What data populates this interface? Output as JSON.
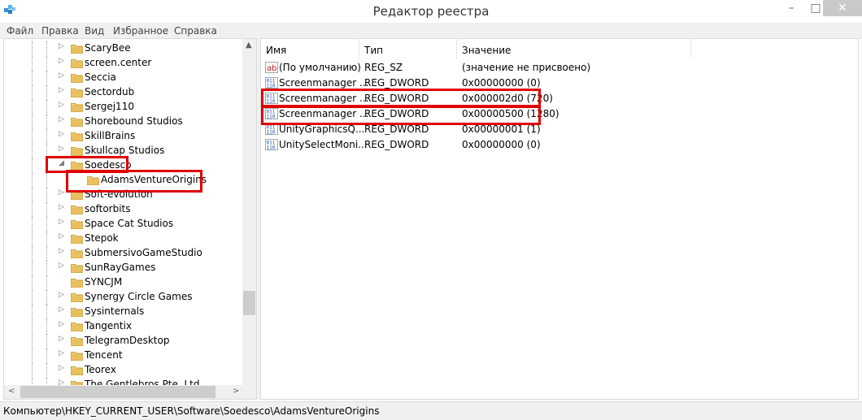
{
  "window": {
    "title": "Редактор реестра",
    "minimize": "–",
    "maximize": "□",
    "close": "✕"
  },
  "menu": [
    "Файл",
    "Правка",
    "Вид",
    "Избранное",
    "Справка"
  ],
  "tree": {
    "items": [
      {
        "label": "ScaryBee",
        "expander": "▷"
      },
      {
        "label": "screen.center",
        "expander": "▷"
      },
      {
        "label": "Seccia",
        "expander": "▷"
      },
      {
        "label": "Sectordub",
        "expander": "▷"
      },
      {
        "label": "Sergej110",
        "expander": "▷"
      },
      {
        "label": "Shorebound Studios",
        "expander": "▷"
      },
      {
        "label": "SkillBrains",
        "expander": "▷"
      },
      {
        "label": "Skullcap Studios",
        "expander": "▷"
      },
      {
        "label": "Soedesco",
        "expander": "◢",
        "highlighted": true
      },
      {
        "label": "AdamsVentureOrigins",
        "expander": "",
        "child": true,
        "selected": true,
        "highlighted": true
      },
      {
        "label": "Soft-evolution",
        "expander": "▷"
      },
      {
        "label": "softorbits",
        "expander": "▷"
      },
      {
        "label": "Space Cat Studios",
        "expander": "▷"
      },
      {
        "label": "Stepok",
        "expander": "▷"
      },
      {
        "label": "SubmersivoGameStudio",
        "expander": "▷"
      },
      {
        "label": "SunRayGames",
        "expander": "▷"
      },
      {
        "label": "SYNCJM",
        "expander": ""
      },
      {
        "label": "Synergy Circle Games",
        "expander": "▷"
      },
      {
        "label": "Sysinternals",
        "expander": "▷"
      },
      {
        "label": "Tangentix",
        "expander": "▷"
      },
      {
        "label": "TelegramDesktop",
        "expander": "▷"
      },
      {
        "label": "Tencent",
        "expander": "▷"
      },
      {
        "label": "Teorex",
        "expander": "▷"
      },
      {
        "label": "The Gentlebros Pte. Ltd",
        "expander": "▷"
      }
    ]
  },
  "scroll": {
    "up": "▲",
    "down": "▼",
    "left": "<",
    "right": ">"
  },
  "values": {
    "columns": {
      "name": "Имя",
      "type": "Тип",
      "data": "Значение"
    },
    "rows": [
      {
        "icon": "ab",
        "name": "(По умолчанию)",
        "type": "REG_SZ",
        "data": "(значение не присвоено)",
        "highlighted": false
      },
      {
        "icon": "dword",
        "name": "Screenmanager ...",
        "type": "REG_DWORD",
        "data": "0x00000000 (0)",
        "highlighted": false
      },
      {
        "icon": "dword",
        "name": "Screenmanager ...",
        "type": "REG_DWORD",
        "data": "0x000002d0 (720)",
        "highlighted": true
      },
      {
        "icon": "dword",
        "name": "Screenmanager ...",
        "type": "REG_DWORD",
        "data": "0x00000500 (1280)",
        "highlighted": true
      },
      {
        "icon": "dword",
        "name": "UnityGraphicsQ...",
        "type": "REG_DWORD",
        "data": "0x00000001 (1)",
        "highlighted": false
      },
      {
        "icon": "dword",
        "name": "UnitySelectMoni...",
        "type": "REG_DWORD",
        "data": "0x00000000 (0)",
        "highlighted": false
      }
    ]
  },
  "status": {
    "path": "Компьютер\\HKEY_CURRENT_USER\\Software\\Soedesco\\AdamsVentureOrigins"
  },
  "colors": {
    "highlight": "#e00000",
    "folder": "#e8c060"
  }
}
